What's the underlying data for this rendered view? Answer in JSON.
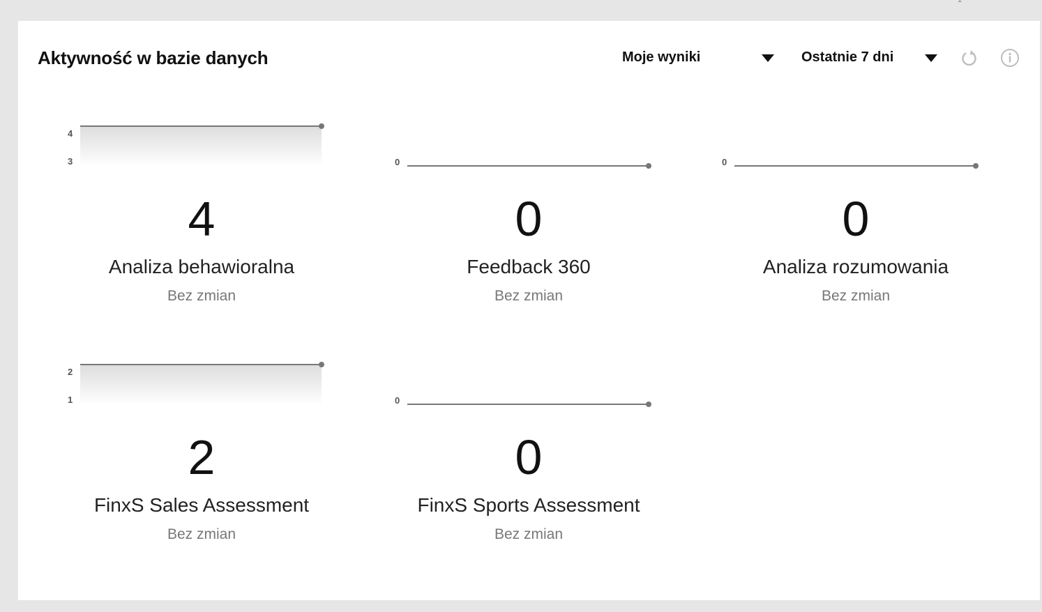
{
  "widget": {
    "title": "Aktywność w bazie danych",
    "results_select": "Moje wyniki",
    "range_select": "Ostatnie 7 dni",
    "refresh_icon": "refresh-icon",
    "info_icon": "info-icon"
  },
  "tiles": [
    {
      "value": "4",
      "name": "Analiza behawioralna",
      "change": "Bez zmian",
      "spark": {
        "ticks": [
          "4",
          "3"
        ],
        "values": [
          4,
          4
        ],
        "filled": true
      }
    },
    {
      "value": "0",
      "name": "Feedback 360",
      "change": "Bez zmian",
      "spark": {
        "ticks": [
          "0"
        ],
        "values": [
          0,
          0
        ],
        "filled": false
      }
    },
    {
      "value": "0",
      "name": "Analiza rozumowania",
      "change": "Bez zmian",
      "spark": {
        "ticks": [
          "0"
        ],
        "values": [
          0,
          0
        ],
        "filled": false
      }
    },
    {
      "value": "2",
      "name": "FinxS Sales Assessment",
      "change": "Bez zmian",
      "spark": {
        "ticks": [
          "2",
          "1"
        ],
        "values": [
          2,
          2
        ],
        "filled": true
      }
    },
    {
      "value": "0",
      "name": "FinxS Sports Assessment",
      "change": "Bez zmian",
      "spark": {
        "ticks": [
          "0"
        ],
        "values": [
          0,
          0
        ],
        "filled": false
      }
    }
  ],
  "colors": {
    "line": "#777777",
    "fill_top": "#dddddd",
    "fill_bottom": "#ffffff"
  }
}
